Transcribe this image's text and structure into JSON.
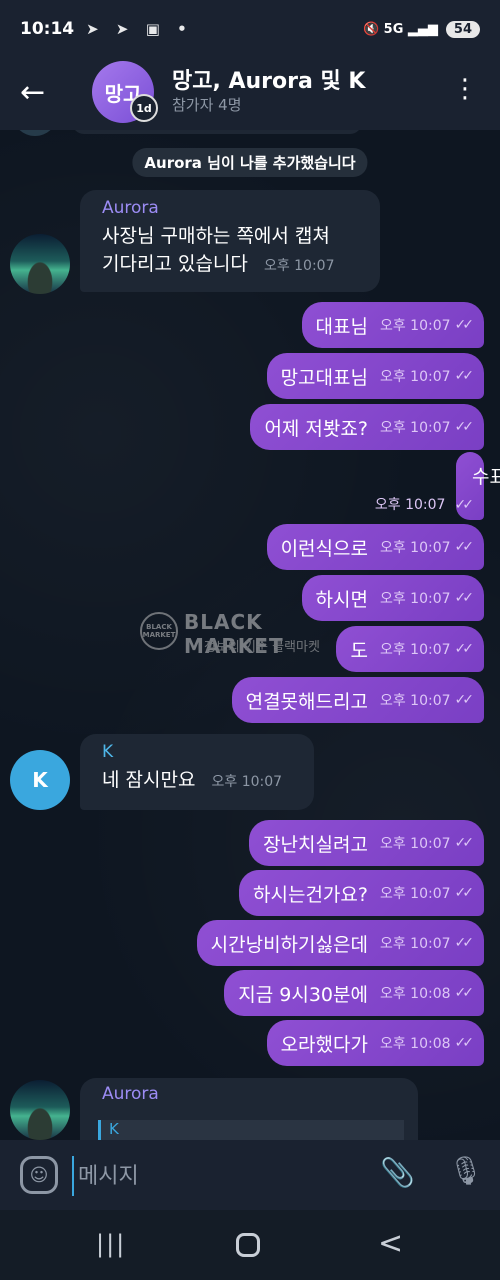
{
  "status_bar": {
    "time": "10:14",
    "icons": "➤ ➤ ▣ •",
    "right_icons": "🔇 5G ▂▄▆",
    "battery": "54"
  },
  "header": {
    "back_icon": "←",
    "avatar_text": "망고",
    "timer_badge": "1d",
    "title": "망고, Aurora 및 K",
    "subtitle": "참가자 4명",
    "menu_icon": "⋮"
  },
  "chat": {
    "service_message": "Aurora 님이 나를 추가했습니다",
    "incoming_1": {
      "sender": "Aurora",
      "sender_color": "#9c8cf4",
      "line1": "사장님 구매하는 쪽에서 캡쳐",
      "line2": "기다리고 있습니다",
      "time": "오후 10:07"
    },
    "outgoing_group_1": [
      {
        "text": "대표님",
        "time": "오후 10:07"
      },
      {
        "text": "망고대표님",
        "time": "오후 10:07"
      },
      {
        "text": "어제 저봣죠?",
        "time": "오후 10:07"
      },
      {
        "text": "수표부터 뭐하나 연결해드릴려해도",
        "time": "오후 10:07"
      },
      {
        "text": "이런식으로",
        "time": "오후 10:07"
      },
      {
        "text": "하시면",
        "time": "오후 10:07"
      },
      {
        "text": "도",
        "time": "오후 10:07"
      },
      {
        "text": "연결못해드리고",
        "time": "오후 10:07"
      }
    ],
    "incoming_2": {
      "sender": "K",
      "sender_color": "#4fb6e8",
      "avatar_letter": "K",
      "text": "네 잠시만요",
      "time": "오후 10:07"
    },
    "outgoing_group_2": [
      {
        "text": "장난치실려고",
        "time": "오후 10:07"
      },
      {
        "text": "하시는건가요?",
        "time": "오후 10:07"
      },
      {
        "text": "시간낭비하기싫은데",
        "time": "오후 10:07"
      },
      {
        "text": "지금 9시30분에",
        "time": "오후 10:08"
      },
      {
        "text": "오라했다가",
        "time": "오후 10:08"
      }
    ],
    "check_marks": "✓✓",
    "incoming_3": {
      "sender": "Aurora",
      "reply_preview": "K"
    },
    "watermark": {
      "logo_text": "BLACK MARKET",
      "title": "BLACK MARKET",
      "subtitle": "정보의 기준 블랙마켓"
    }
  },
  "input_bar": {
    "emoji_icon": "☺",
    "placeholder": "메시지",
    "attach_icon": "📎",
    "mic_icon": "🎙"
  },
  "nav_bar": {
    "recent_icon": "|||",
    "back_icon": "<"
  }
}
